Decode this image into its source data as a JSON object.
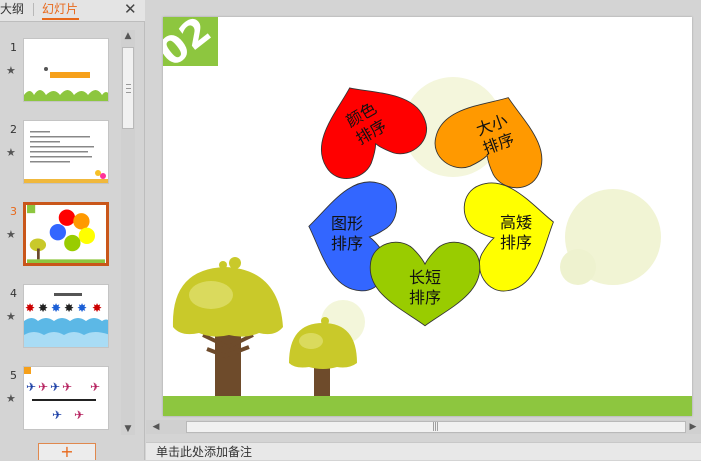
{
  "sidebar": {
    "tabs": [
      {
        "label": "大纲"
      },
      {
        "label": "幻灯片",
        "active": true
      }
    ],
    "close_glyph": "✕",
    "slides": [
      {
        "number": "1",
        "star": "★",
        "active": false
      },
      {
        "number": "2",
        "star": "★",
        "active": false
      },
      {
        "number": "3",
        "star": "★",
        "active": true
      },
      {
        "number": "4",
        "star": "★",
        "active": false
      },
      {
        "number": "5",
        "star": "★",
        "active": false
      }
    ],
    "add_slide_label": "+"
  },
  "slide": {
    "badge": "02",
    "petals": [
      {
        "label_line1": "颜色",
        "label_line2": "排序",
        "color": "#ff0000"
      },
      {
        "label_line1": "大小",
        "label_line2": "排序",
        "color": "#ff9900"
      },
      {
        "label_line1": "图形",
        "label_line2": "排序",
        "color": "#3366ff"
      },
      {
        "label_line1": "高矮",
        "label_line2": "排序",
        "color": "#ffff00"
      },
      {
        "label_line1": "长短",
        "label_line2": "排序",
        "color": "#99cc00"
      }
    ],
    "badge_color": "#8dc63f",
    "ground_color": "#8dc63f"
  },
  "scroll": {
    "up": "▲",
    "down": "▼",
    "left": "◀",
    "right": "▶",
    "grip": "|||"
  },
  "notes": {
    "placeholder": "单击此处添加备注"
  }
}
